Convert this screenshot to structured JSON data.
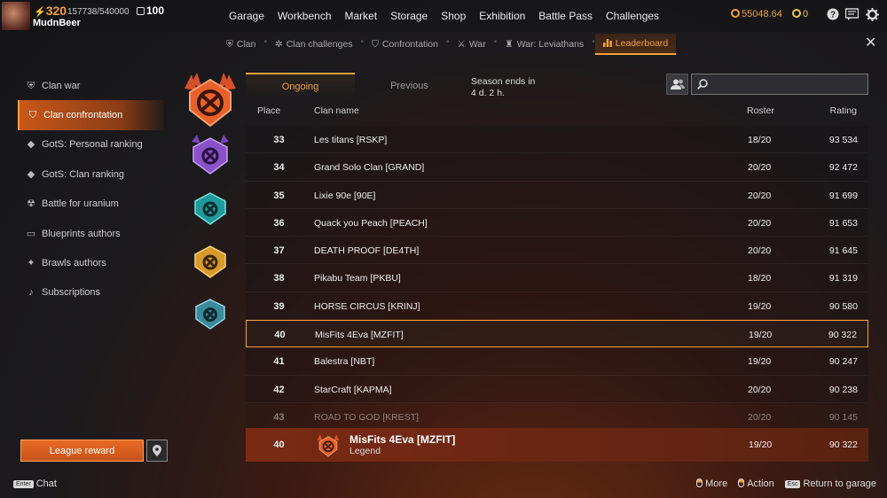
{
  "player": {
    "level": "320",
    "xp": "157738/540000",
    "rank": "100",
    "name": "MudnBeer"
  },
  "nav": {
    "items": [
      "Garage",
      "Workbench",
      "Market",
      "Storage",
      "Shop",
      "Exhibition",
      "Battle Pass",
      "Challenges"
    ]
  },
  "currency": {
    "coins": "55048.64",
    "badges": "0"
  },
  "subnav": {
    "items": [
      "Clan",
      "Clan challenges",
      "Confrontation",
      "War",
      "War: Leviathans",
      "Leaderboard"
    ],
    "active": "Leaderboard"
  },
  "sidebar": {
    "items": [
      "Clan war",
      "Clan confrontation",
      "GotS: Personal ranking",
      "GotS: Clan ranking",
      "Battle for uranium",
      "Blueprints authors",
      "Brawls authors",
      "Subscriptions"
    ],
    "active": "Clan confrontation"
  },
  "tabs": {
    "ongoing": "Ongoing",
    "previous": "Previous"
  },
  "season": {
    "line1": "Season ends in",
    "line2": "4 d. 2 h."
  },
  "search": {
    "placeholder": ""
  },
  "table": {
    "headers": {
      "place": "Place",
      "clan": "Clan name",
      "roster": "Roster",
      "rating": "Rating"
    },
    "rows": [
      {
        "place": "33",
        "clan": "Les titans [RSKP]",
        "roster": "18/20",
        "rating": "93 534"
      },
      {
        "place": "34",
        "clan": "Grand Solo Clan [GRAND]",
        "roster": "20/20",
        "rating": "92 472"
      },
      {
        "place": "35",
        "clan": "Lixie 90e [90E]",
        "roster": "20/20",
        "rating": "91 699"
      },
      {
        "place": "36",
        "clan": "Quack you Peach [PEACH]",
        "roster": "20/20",
        "rating": "91 653"
      },
      {
        "place": "37",
        "clan": "DEATH PROOF [DE4TH]",
        "roster": "20/20",
        "rating": "91 645"
      },
      {
        "place": "38",
        "clan": "Pikabu Team [PKBU]",
        "roster": "18/20",
        "rating": "91 319"
      },
      {
        "place": "39",
        "clan": "HORSE CIRCUS [KRINJ]",
        "roster": "19/20",
        "rating": "90 580"
      },
      {
        "place": "40",
        "clan": "MisFits 4Eva [MZFIT]",
        "roster": "19/20",
        "rating": "90 322"
      },
      {
        "place": "41",
        "clan": "Balestra [NBT]",
        "roster": "19/20",
        "rating": "90 247"
      },
      {
        "place": "42",
        "clan": "StarCraft [KAPMA]",
        "roster": "20/20",
        "rating": "90 238"
      },
      {
        "place": "43",
        "clan": "ROAD TO GOD [KREST]",
        "roster": "20/20",
        "rating": "90 145"
      }
    ]
  },
  "my_clan": {
    "place": "40",
    "clan": "MisFits 4Eva [MZFIT]",
    "league": "Legend",
    "roster": "19/20",
    "rating": "90 322"
  },
  "league_reward": "League reward",
  "footer": {
    "chat_key": "Enter",
    "chat": "Chat",
    "more": "More",
    "action": "Action",
    "return_key": "Esc",
    "return": "Return to garage"
  },
  "colors": {
    "accent": "#f0a23c",
    "highlight_row": "#7a2a12",
    "emblems": [
      "#e8602a",
      "#8a52c8",
      "#1f9a9a",
      "#d89a2a",
      "#3a8a9a"
    ]
  }
}
